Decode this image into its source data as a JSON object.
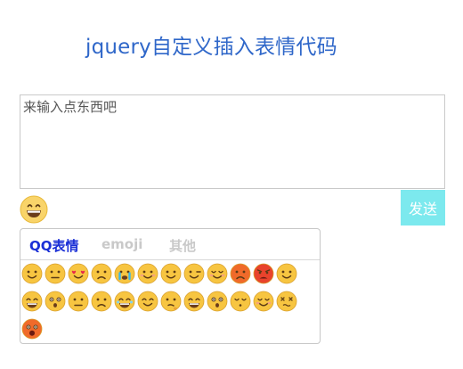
{
  "page": {
    "title": "jquery自定义插入表情代码"
  },
  "composer": {
    "placeholder": "来输入点东西吧",
    "value": "",
    "emoji_button_icon": "grinning-face-icon",
    "send_label": "发送"
  },
  "emoji_panel": {
    "tabs": [
      {
        "label": "QQ表情",
        "active": true
      },
      {
        "label": "emoji",
        "active": false
      },
      {
        "label": "其他",
        "active": false
      }
    ],
    "emojis": [
      {
        "name": "smile-face-icon",
        "kind": "smile",
        "color": "#f7c541"
      },
      {
        "name": "grimace-face-icon",
        "kind": "grimace",
        "color": "#f7c541"
      },
      {
        "name": "heart-eyes-face-icon",
        "kind": "hearteyes",
        "color": "#f7c541"
      },
      {
        "name": "frown-face-icon",
        "kind": "frown",
        "color": "#f7c541"
      },
      {
        "name": "crying-face-icon",
        "kind": "crying",
        "color": "#f7c541"
      },
      {
        "name": "shy-face-icon",
        "kind": "shy",
        "color": "#f7c541"
      },
      {
        "name": "proud-face-icon",
        "kind": "proud",
        "color": "#f7c541"
      },
      {
        "name": "wink-face-icon",
        "kind": "wink",
        "color": "#f7c541"
      },
      {
        "name": "blush-face-icon",
        "kind": "blush",
        "color": "#f7c541"
      },
      {
        "name": "sad-red-face-icon",
        "kind": "sad",
        "color": "#f06a2a"
      },
      {
        "name": "angry-face-icon",
        "kind": "angry",
        "color": "#e8432c"
      },
      {
        "name": "smile-face-icon",
        "kind": "smile",
        "color": "#f7c541"
      },
      {
        "name": "grin-face-icon",
        "kind": "grin",
        "color": "#f7c541"
      },
      {
        "name": "surprised-face-icon",
        "kind": "surprised",
        "color": "#f7c541"
      },
      {
        "name": "neutral-face-icon",
        "kind": "neutral",
        "color": "#f7c541"
      },
      {
        "name": "worried-face-icon",
        "kind": "worried",
        "color": "#f7c541"
      },
      {
        "name": "laughing-tears-face-icon",
        "kind": "laughtears",
        "color": "#f7c541"
      },
      {
        "name": "squint-face-icon",
        "kind": "squint",
        "color": "#f7c541"
      },
      {
        "name": "thinking-face-icon",
        "kind": "thinking",
        "color": "#f7c541"
      },
      {
        "name": "happy-face-icon",
        "kind": "happy",
        "color": "#f7c541"
      },
      {
        "name": "shocked-face-icon",
        "kind": "shocked",
        "color": "#f7c541"
      },
      {
        "name": "sleepy-face-icon",
        "kind": "sleepy",
        "color": "#f7c541"
      },
      {
        "name": "content-face-icon",
        "kind": "content",
        "color": "#f7c541"
      },
      {
        "name": "dizzy-face-icon",
        "kind": "dizzy",
        "color": "#f7c541"
      },
      {
        "name": "screaming-face-icon",
        "kind": "scream",
        "color": "#f06a2a"
      }
    ]
  }
}
